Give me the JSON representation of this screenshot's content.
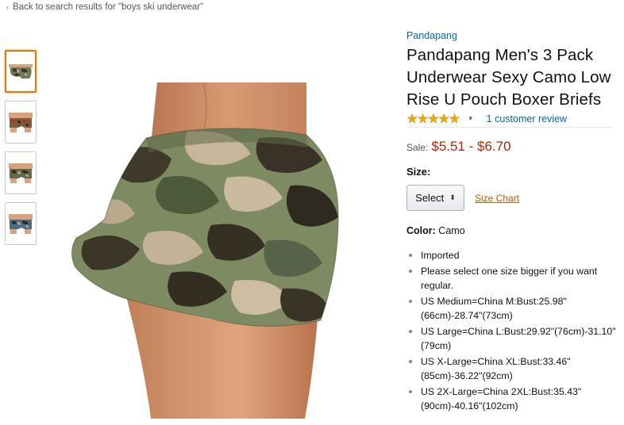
{
  "nav": {
    "back_link": "Back to search results for \"boys ski underwear\""
  },
  "product": {
    "brand": "Pandapang",
    "title": "Pandapang Men's 3 Pack Underwear Sexy Camo Low Rise U Pouch Boxer Briefs",
    "rating_stars": 5,
    "review_link": "1 customer review",
    "price_label": "Sale:",
    "price": "$5.51 - $6.70",
    "price_color": "#b12704",
    "size_label": "Size:",
    "size_select": "Select",
    "size_chart": "Size Chart",
    "color_label": "Color:",
    "color_value": "Camo",
    "features": [
      "Imported",
      "Please select one size bigger if you want regular.",
      "US Medium=China M:Bust:25.98\"(66cm)-28.74\"(73cm)",
      "US Large=China L:Bust:29.92\"(76cm)-31.10\"(79cm)",
      "US X-Large=China XL:Bust:33.46\"(85cm)-36.22\"(92cm)",
      "US 2X-Large=China 2XL:Bust:35.43\"(90cm)-40.16\"(102cm)"
    ]
  },
  "gallery": {
    "thumbnail_count": 4,
    "selected_index": 0
  },
  "theme": {
    "link_color": "#0066c0",
    "accent_orange": "#e77600",
    "size_chart_color": "#c45500",
    "star_color": "#f2a900"
  }
}
